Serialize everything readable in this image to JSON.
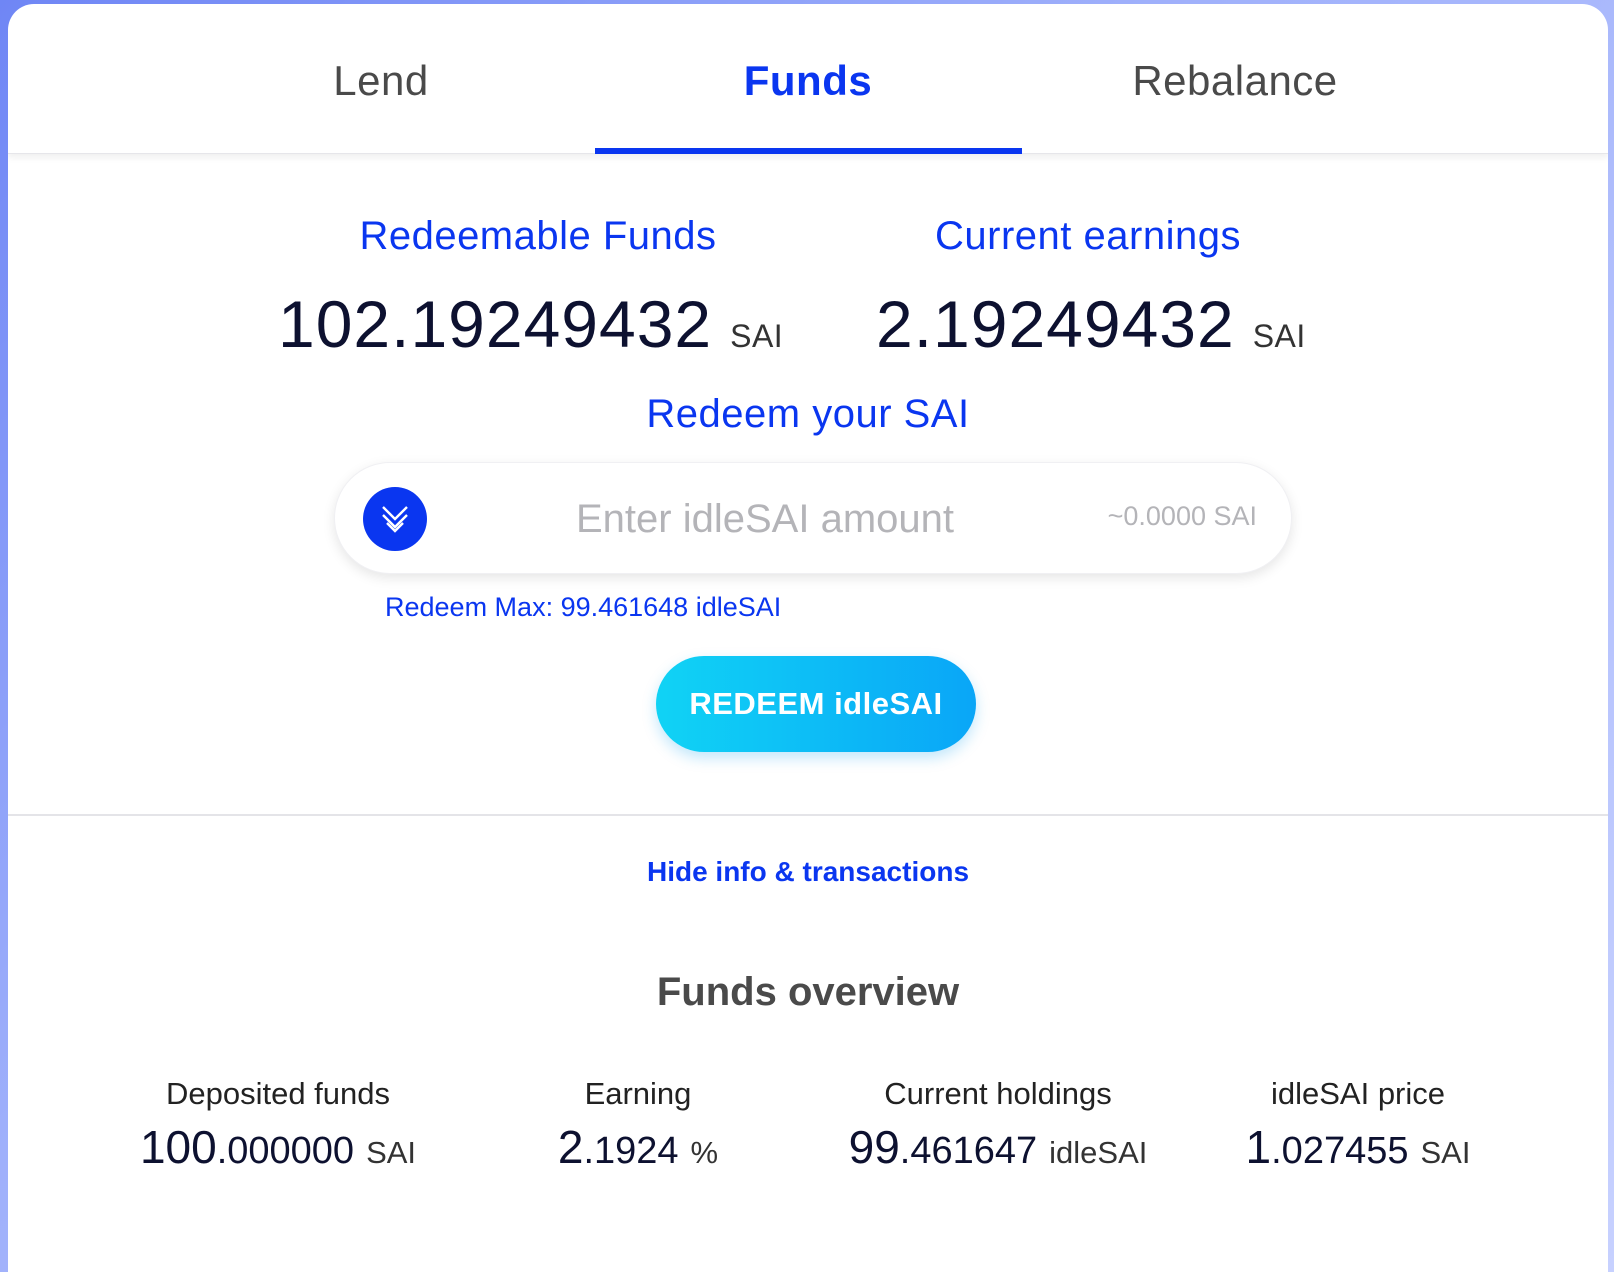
{
  "tabs": [
    {
      "label": "Lend",
      "active": false
    },
    {
      "label": "Funds",
      "active": true
    },
    {
      "label": "Rebalance",
      "active": false
    }
  ],
  "stats": {
    "redeemable": {
      "label": "Redeemable Funds",
      "value": "102.19249432",
      "unit": "SAI"
    },
    "earnings": {
      "label": "Current earnings",
      "value": "2.19249432",
      "unit": "SAI"
    }
  },
  "redeem": {
    "title": "Redeem your SAI",
    "input_placeholder": "Enter idleSAI amount",
    "input_value": "",
    "conversion": "~0.0000 SAI",
    "max_label": "Redeem Max: 99.461648 idleSAI",
    "button_label": "REDEEM idleSAI",
    "icon": "chevrons-down-icon"
  },
  "toggle_info_label": "Hide info & transactions",
  "overview": {
    "title": "Funds overview",
    "items": [
      {
        "label": "Deposited funds",
        "int": "100",
        "dec": ".000000",
        "unit": "SAI"
      },
      {
        "label": "Earning",
        "int": "2",
        "dec": ".1924",
        "unit": "%"
      },
      {
        "label": "Current holdings",
        "int": "99",
        "dec": ".461647",
        "unit": "idleSAI"
      },
      {
        "label": "idleSAI price",
        "int": "1",
        "dec": ".027455",
        "unit": "SAI"
      }
    ]
  },
  "colors": {
    "accent": "#0a36f0",
    "button_gradient_start": "#10d3f5",
    "button_gradient_end": "#0aa6f7",
    "text_dark": "#0d1130"
  }
}
